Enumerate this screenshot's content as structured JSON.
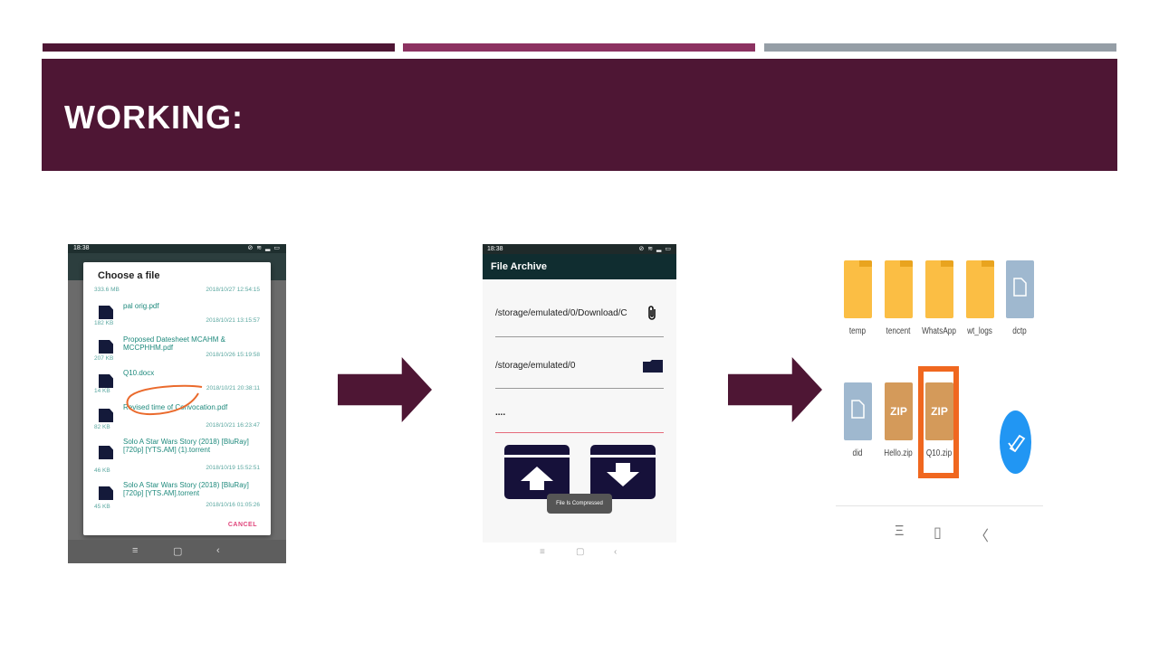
{
  "slide": {
    "title": "WORKING:",
    "colors": {
      "accent_dark": "#4e1634",
      "accent_mid": "#8c3261",
      "accent_grey": "#959ea6"
    }
  },
  "phone1": {
    "status_time": "18:38",
    "status_icons": "⊘ ≋ ▂ ▭",
    "dialog_title": "Choose a file",
    "files": [
      {
        "name": "",
        "size": "333.6 MB",
        "date": "2018/10/27 12:54:15"
      },
      {
        "name": "pal orig.pdf",
        "size": "182 KB",
        "date": "2018/10/21 13:15:57"
      },
      {
        "name": "Proposed Datesheet MCAHM & MCCPHHM.pdf",
        "size": "207 KB",
        "date": "2018/10/26 15:19:58"
      },
      {
        "name": "Q10.docx",
        "size": "14 KB",
        "date": "2018/10/21 20:38:11"
      },
      {
        "name": "Revised time of Convocation.pdf",
        "size": "82 KB",
        "date": "2018/10/21 16:23:47"
      },
      {
        "name": "Solo A Star Wars Story (2018) [BluRay] [720p] [YTS.AM] (1).torrent",
        "size": "46 KB",
        "date": "2018/10/19 15:52:51"
      },
      {
        "name": "Solo A Star Wars Story (2018) [BluRay] [720p] [YTS.AM].torrent",
        "size": "45 KB",
        "date": "2018/10/16 01:05:26"
      }
    ],
    "cancel_label": "CANCEL",
    "nav": {
      "menu": "≡",
      "home": "▢",
      "back": "‹"
    }
  },
  "phone2": {
    "status_time": "18:38",
    "status_icons": "⊘ ≋ ▂ ▭",
    "app_title": "File Archive",
    "source_path": "/storage/emulated/0/Download/C",
    "dest_path": "/storage/emulated/0",
    "password": "....",
    "toast": "File Is Compressed",
    "attach_icon": "paperclip-icon",
    "folder_icon": "folder-icon",
    "nav": {
      "menu": "≡",
      "home": "▢",
      "back": "‹"
    }
  },
  "file_manager": {
    "row1": [
      {
        "label": "temp",
        "type": "folder"
      },
      {
        "label": "tencent",
        "type": "folder"
      },
      {
        "label": "WhatsApp",
        "type": "folder"
      },
      {
        "label": "wt_logs",
        "type": "folder"
      },
      {
        "label": "dctp",
        "type": "doc"
      }
    ],
    "row2": [
      {
        "label": "did",
        "type": "doc"
      },
      {
        "label": "Hello.zip",
        "type": "zip",
        "badge": "ZIP"
      },
      {
        "label": "Q10.zip",
        "type": "zip",
        "badge": "ZIP"
      }
    ],
    "nav": {
      "menu": "Ξ",
      "home": "▯",
      "back": "〈"
    }
  }
}
